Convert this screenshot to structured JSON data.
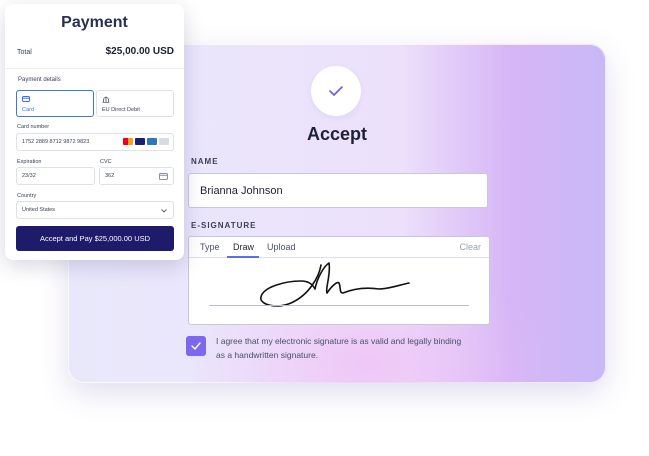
{
  "accept": {
    "title": "Accept",
    "name_label": "NAME",
    "name_value": "Brianna Johnson",
    "signature_label": "E-SIGNATURE",
    "tabs": [
      {
        "label": "Type",
        "active": false
      },
      {
        "label": "Draw",
        "active": true
      },
      {
        "label": "Upload",
        "active": false
      }
    ],
    "clear_label": "Clear",
    "agree_text": "I agree that my electronic signature is as valid and legally binding as a handwritten signature.",
    "agree_checked": true
  },
  "payment": {
    "title": "Payment",
    "total_label": "Total",
    "total_value": "$25,00.00 USD",
    "details_label": "Payment details",
    "methods": [
      {
        "label": "Card",
        "icon": "card-icon",
        "selected": true
      },
      {
        "label": "EU Direct Debit",
        "icon": "bank-icon",
        "selected": false
      }
    ],
    "card_number_label": "Card number",
    "card_number_value": "1752 2889 8712 9872 9823",
    "expiration_label": "Expiration",
    "expiration_value": "23/32",
    "cvc_label": "CVC",
    "cvc_value": "362",
    "country_label": "Country",
    "country_value": "United States",
    "button_label": "Accept and Pay $25,000.00 USD"
  },
  "colors": {
    "accent": "#7b68ee",
    "pay_button": "#1f1b6b",
    "selected_border": "#3b74f0"
  }
}
